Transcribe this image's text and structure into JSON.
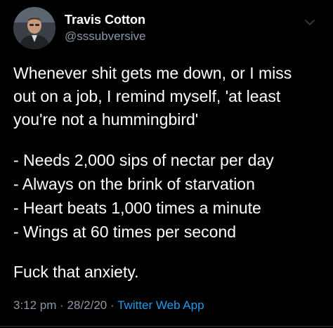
{
  "user": {
    "display_name": "Travis Cotton",
    "handle": "@sssubversive"
  },
  "tweet": {
    "lines": [
      "Whenever shit gets me down, or I miss",
      "out on a job, I remind myself, 'at least",
      "you're not a hummingbird'"
    ],
    "bullets": [
      "- Needs 2,000 sips of nectar per day",
      "- Always on the brink of starvation",
      "- Heart beats 1,000 times a minute",
      "- Wings at 60 times per second"
    ],
    "closing": "Fuck that anxiety."
  },
  "meta": {
    "time": "3:12 pm",
    "separator1": " · ",
    "date": "28/2/20",
    "separator2": " · ",
    "source": "Twitter Web App"
  },
  "icons": {
    "avatar": "user-avatar",
    "menu": "chevron-down-icon"
  },
  "colors": {
    "background": "#000000",
    "text": "#ffffff",
    "secondary": "#8b98a5",
    "link": "#1d9bf0"
  }
}
